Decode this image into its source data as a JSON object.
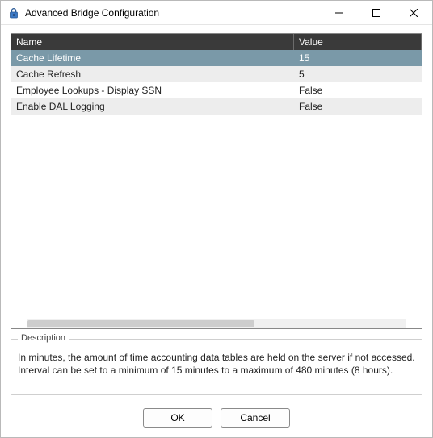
{
  "window": {
    "title": "Advanced Bridge Configuration",
    "icon": "lock-icon"
  },
  "grid": {
    "columns": {
      "name": "Name",
      "value": "Value"
    },
    "rows": [
      {
        "name": "Cache Lifetime",
        "value": "15",
        "selected": true
      },
      {
        "name": "Cache Refresh",
        "value": "5",
        "selected": false
      },
      {
        "name": "Employee Lookups - Display SSN",
        "value": "False",
        "selected": false
      },
      {
        "name": "Enable DAL Logging",
        "value": "False",
        "selected": false
      }
    ]
  },
  "description": {
    "legend": "Description",
    "text": "In minutes, the amount of time accounting data tables are held on the server if not accessed. Interval can be set to a minimum of 15 minutes to a maximum of 480 minutes (8 hours)."
  },
  "buttons": {
    "ok": "OK",
    "cancel": "Cancel"
  }
}
